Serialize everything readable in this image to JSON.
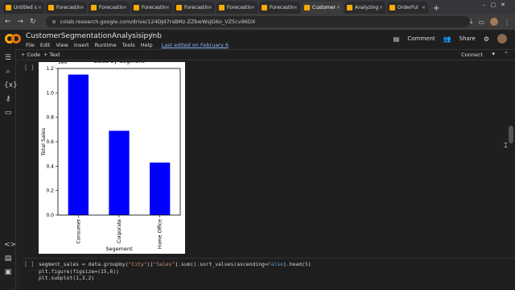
{
  "browser": {
    "tabs": [
      {
        "label": "Untitled s",
        "color": "#f9ab00",
        "active": false
      },
      {
        "label": "Forecastin",
        "color": "#f9ab00",
        "active": false
      },
      {
        "label": "Forecastin",
        "color": "#f9ab00",
        "active": false
      },
      {
        "label": "Forecastin",
        "color": "#f9ab00",
        "active": false
      },
      {
        "label": "Forecastin",
        "color": "#f9ab00",
        "active": false
      },
      {
        "label": "Forecastin",
        "color": "#f9ab00",
        "active": false
      },
      {
        "label": "Forecastin",
        "color": "#f9ab00",
        "active": false
      },
      {
        "label": "Customer",
        "color": "#f9ab00",
        "active": true
      },
      {
        "label": "Analyzing",
        "color": "#f9ab00",
        "active": false
      },
      {
        "label": "OrderFul",
        "color": "#f9ab00",
        "active": false
      }
    ],
    "new_tab": "+",
    "url": "colab.research.google.com/drive/124DJd7rsBMz-ZZbwWsJG6o_VZ5cv96DX"
  },
  "colab": {
    "title": "CustomerSegmentationAnalysisipynb",
    "menu": [
      "File",
      "Edit",
      "View",
      "Insert",
      "Runtime",
      "Tools",
      "Help"
    ],
    "last_edited": "Last edited on February 6",
    "comment_label": "Comment",
    "share_label": "Share",
    "add_code": "+ Code",
    "add_text": "+ Text",
    "connect_label": "Connect"
  },
  "cells": {
    "output_bracket": "[ ]",
    "code_bracket": "[ ]"
  },
  "chart_data": {
    "type": "bar",
    "title": "Sales by Segment",
    "offset_label": "1e6",
    "xlabel": "Segement",
    "ylabel": "Total Sales",
    "categories": [
      "Consumer",
      "Corporate",
      "Home Office"
    ],
    "values": [
      1.15,
      0.69,
      0.43
    ],
    "ylim": [
      0,
      1.2
    ],
    "yticks": [
      "0.0",
      "0.2",
      "0.4",
      "0.6",
      "0.8",
      "1.0",
      "1.2"
    ],
    "bar_color": "#0000ff",
    "grid": false
  },
  "code_lines": {
    "line1_a": "segment_sales = data.groupby(",
    "line1_b": "\"City\"",
    "line1_c": ")[",
    "line1_d": "\"Sales\"",
    "line1_e": "].sum().sort_values(ascending=",
    "line1_f": "False",
    "line1_g": ").head(",
    "line1_h": "5",
    "line1_i": ")",
    "line2": "plt.figure(figsize=(15,6))",
    "line3": "plt.subplot(1,3,2)"
  }
}
